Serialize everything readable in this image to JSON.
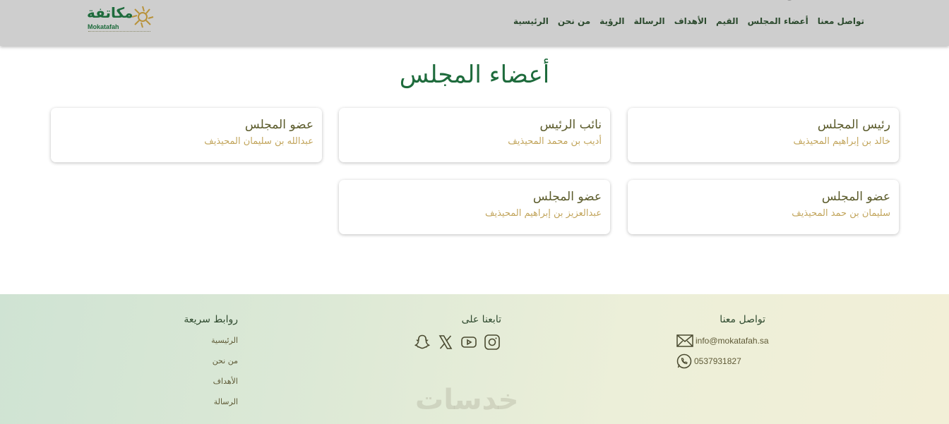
{
  "header": {
    "logo_arabic": "مكاتفة",
    "logo_english": "Mokatafah",
    "nav": [
      "الرئيسية",
      "من نحن",
      "الرؤية",
      "الرسالة",
      "الأهداف",
      "القيم",
      "أعضاء المجلس",
      "تواصل معنا"
    ]
  },
  "page_title": "أعضاء المجلس",
  "members": [
    {
      "role": "رئيس المجلس",
      "name": "خالد بن إبراهيم المحيذيف"
    },
    {
      "role": "نائب الرئيس",
      "name": "أديب بن محمد المحيذيف"
    },
    {
      "role": "عضو المجلس",
      "name": "عبدالله بن سليمان المحيذيف"
    },
    {
      "role": "عضو المجلس",
      "name": "سليمان بن حمد المحيذيف"
    },
    {
      "role": "عضو المجلس",
      "name": "عبدالعزيز بن إبراهيم المحيذيف"
    }
  ],
  "footer": {
    "contact": {
      "heading": "تواصل معنا",
      "email": "info@mokatafah.sa",
      "phone": "0537931827",
      "email_icon": "mail-icon",
      "phone_icon": "whatsapp-icon"
    },
    "follow": {
      "heading": "تابعنا على",
      "icons": [
        "instagram-icon",
        "youtube-icon",
        "x-icon",
        "snapchat-icon"
      ]
    },
    "quick_links": {
      "heading": "روابط سريعة",
      "links": [
        "الرئيسية",
        "من نحن",
        "الأهداف",
        "الرسالة"
      ]
    },
    "watermark": "خدسات"
  },
  "colors": {
    "header_bg": "#cecece",
    "brand_green": "#1e6b3c",
    "name_gold": "#c2a55c",
    "role_olive": "#5a5a2a"
  }
}
